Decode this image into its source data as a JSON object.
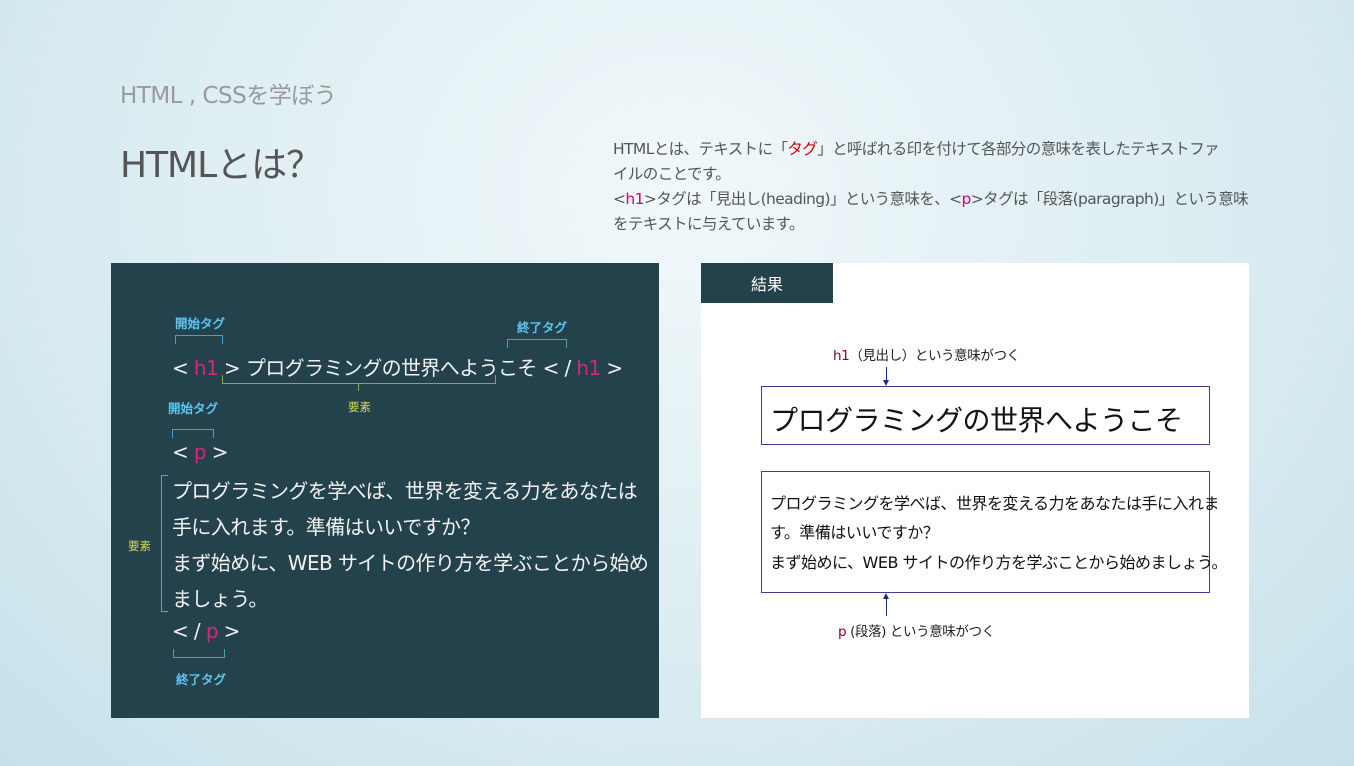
{
  "subtitle": "HTML , CSSを学ぼう",
  "title": "HTMLとは？",
  "description": {
    "l1_a": "HTMLとは、テキストに「",
    "l1_b": "タグ",
    "l1_c": "」と呼ばれる印を付けて各部分の意味を表したテキストファ",
    "l2": "イルのことです。",
    "l3_a": "<",
    "l3_b": "h1",
    "l3_c": ">タグは「見出し(heading)」という意味を、<",
    "l3_d": "p",
    "l3_e": ">タグは「段落(paragraph)」という意味",
    "l4": "をテキストに与えています。"
  },
  "code_panel": {
    "start_tag_label": "開始タグ",
    "end_tag_label": "終了タグ",
    "element_label": "要素",
    "h1_open": "< ",
    "h1_tag": "h1",
    "h1_open_close": " > ",
    "h1_text": "プログラミングの世界へようこそ",
    "h1_close_a": " < / ",
    "h1_close_tag": "h1",
    "h1_close_b": " >",
    "p_open_a": "< ",
    "p_tag": "p",
    "p_open_b": " >",
    "p_lines": [
      "プログラミングを学べば、世界を変える力をあなたは",
      "手に入れます。準備はいいですか？",
      "まず始めに、WEB サイトの作り方を学ぶことから始め",
      "ましょう。"
    ],
    "p_close_a": "< / ",
    "p_close_tag": "p",
    "p_close_b": " >"
  },
  "result_panel": {
    "tab_label": "結果",
    "h1_anno_tag": "h1",
    "h1_anno_text": "（見出し）という意味がつく",
    "h1_render": "プログラミングの世界へようこそ",
    "p_render_lines": [
      "プログラミングを学べば、世界を変える力をあなたは手に入れま",
      "す。準備はいいですか？",
      "まず始めに、WEB サイトの作り方を学ぶことから始めましょう。"
    ],
    "p_anno_tag": "p",
    "p_anno_text": "(段落) という意味がつく"
  },
  "colors": {
    "panel": "#24424c",
    "tag_pink": "#d4267f",
    "tag_label_blue": "#5ec3f0",
    "element_label": "#d0d65a"
  }
}
